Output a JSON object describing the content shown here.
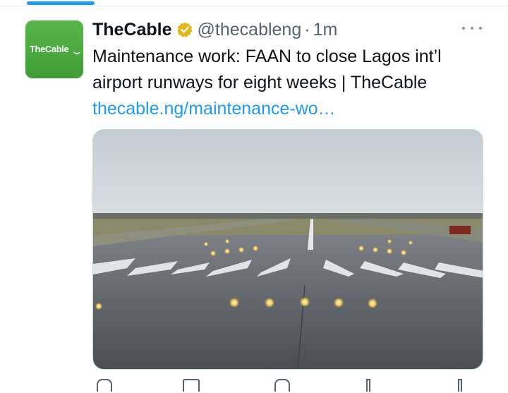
{
  "tweet": {
    "author_name": "TheCable",
    "handle": "@thecableng",
    "separator": "·",
    "time": "1m",
    "text": "Maintenance work: FAAN to close Lagos int’l airport runways for eight weeks | TheCable ",
    "link": "thecable.ng/maintenance-wo…",
    "avatar_text": "TheCable",
    "verified_color": "#e2b719",
    "link_color": "#1d9bf0"
  },
  "icons": {
    "verified": "verified-badge-icon",
    "more": "more-options-icon"
  }
}
